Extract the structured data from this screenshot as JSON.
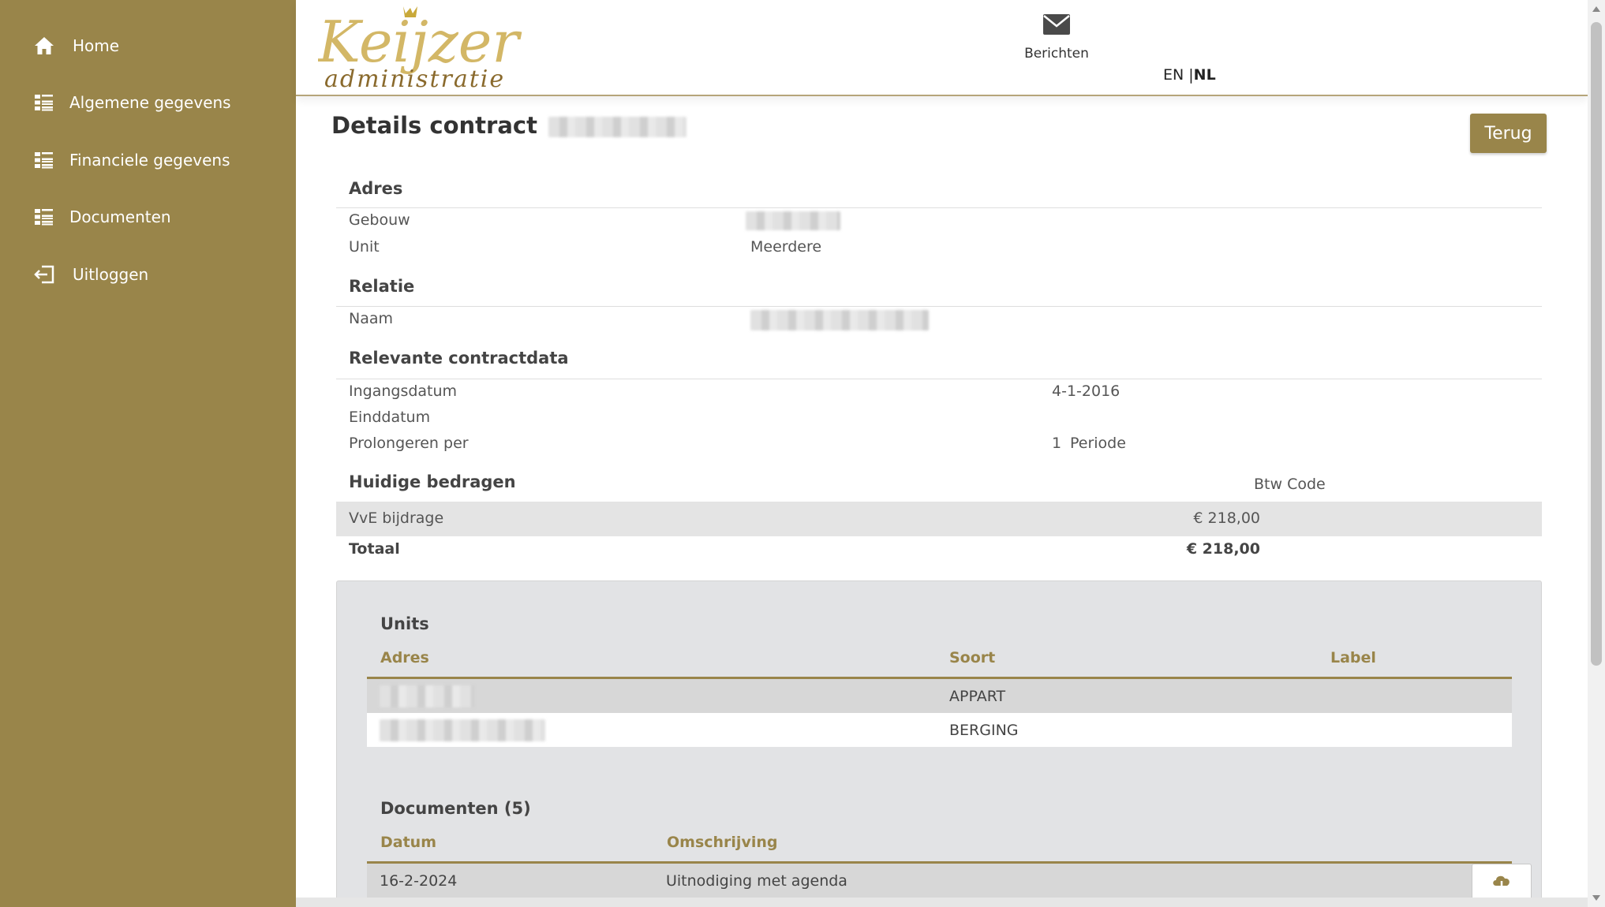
{
  "sidebar": {
    "items": [
      {
        "label": "Home",
        "icon": "home-icon"
      },
      {
        "label": "Algemene gegevens",
        "icon": "list-icon"
      },
      {
        "label": "Financiele gegevens",
        "icon": "list-icon"
      },
      {
        "label": "Documenten",
        "icon": "list-icon"
      },
      {
        "label": "Uitloggen",
        "icon": "logout-icon"
      }
    ],
    "background": "#99854a"
  },
  "header": {
    "logo_text": "Keijzer",
    "logo_subtext": "administratie",
    "messages_label": "Berichten",
    "lang_en": "EN",
    "lang_sep": "|",
    "lang_nl": "NL"
  },
  "page": {
    "title": "Details contract",
    "back_button": "Terug"
  },
  "adres": {
    "heading": "Adres",
    "gebouw_label": "Gebouw",
    "unit_label": "Unit",
    "unit_value": "Meerdere"
  },
  "relatie": {
    "heading": "Relatie",
    "naam_label": "Naam"
  },
  "contractdata": {
    "heading": "Relevante contractdata",
    "ingangsdatum_label": "Ingangsdatum",
    "ingangsdatum_value": "4-1-2016",
    "einddatum_label": "Einddatum",
    "prolongeren_label": "Prolongeren per",
    "prolongeren_count": "1",
    "prolongeren_unit": "Periode"
  },
  "bedragen": {
    "heading": "Huidige bedragen",
    "btw_header": "Btw Code",
    "rows": [
      {
        "label": "VvE bijdrage",
        "amount": "€ 218,00"
      }
    ],
    "total_label": "Totaal",
    "total_amount": "€ 218,00"
  },
  "units": {
    "heading": "Units",
    "columns": [
      "Adres",
      "Soort",
      "Label"
    ],
    "rows": [
      {
        "soort": "APPART"
      },
      {
        "soort": "BERGING"
      }
    ]
  },
  "documenten": {
    "heading": "Documenten (5)",
    "columns": [
      "Datum",
      "Omschrijving"
    ],
    "rows": [
      {
        "datum": "16-2-2024",
        "omschrijving": "Uitnodiging met agenda"
      }
    ]
  },
  "colors": {
    "accent": "#99854a",
    "band": "#e4e4e4",
    "card": "#e2e3e5"
  }
}
